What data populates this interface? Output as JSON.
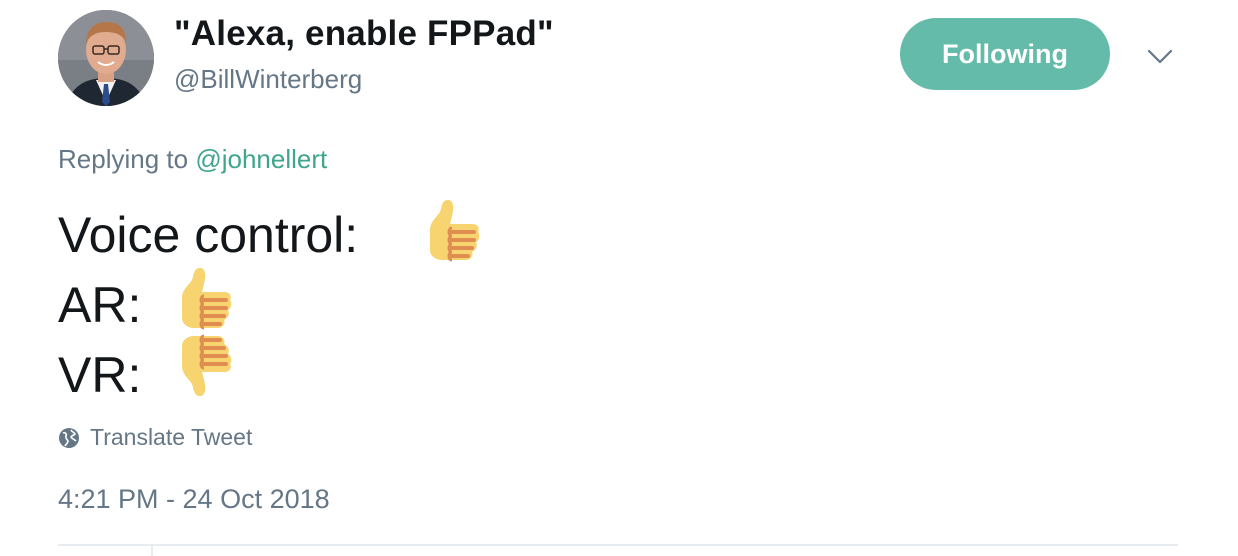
{
  "user": {
    "display_name": "\"Alexa, enable FPPad\"",
    "handle": "@BillWinterberg"
  },
  "follow_button": {
    "label": "Following",
    "color": "#65bba9"
  },
  "reply": {
    "prefix": "Replying to ",
    "mention": "@johnellert"
  },
  "tweet": {
    "lines": [
      {
        "label": "Voice control:",
        "emoji": "thumbs-up"
      },
      {
        "label": "AR:",
        "emoji": "thumbs-up"
      },
      {
        "label": "VR:",
        "emoji": "thumbs-down"
      }
    ]
  },
  "translate": {
    "label": "Translate Tweet",
    "icon": "globe-icon"
  },
  "timestamp": "4:21 PM - 24 Oct 2018",
  "colors": {
    "accent": "#3fa58e",
    "muted": "#657786",
    "text": "#14171a"
  }
}
